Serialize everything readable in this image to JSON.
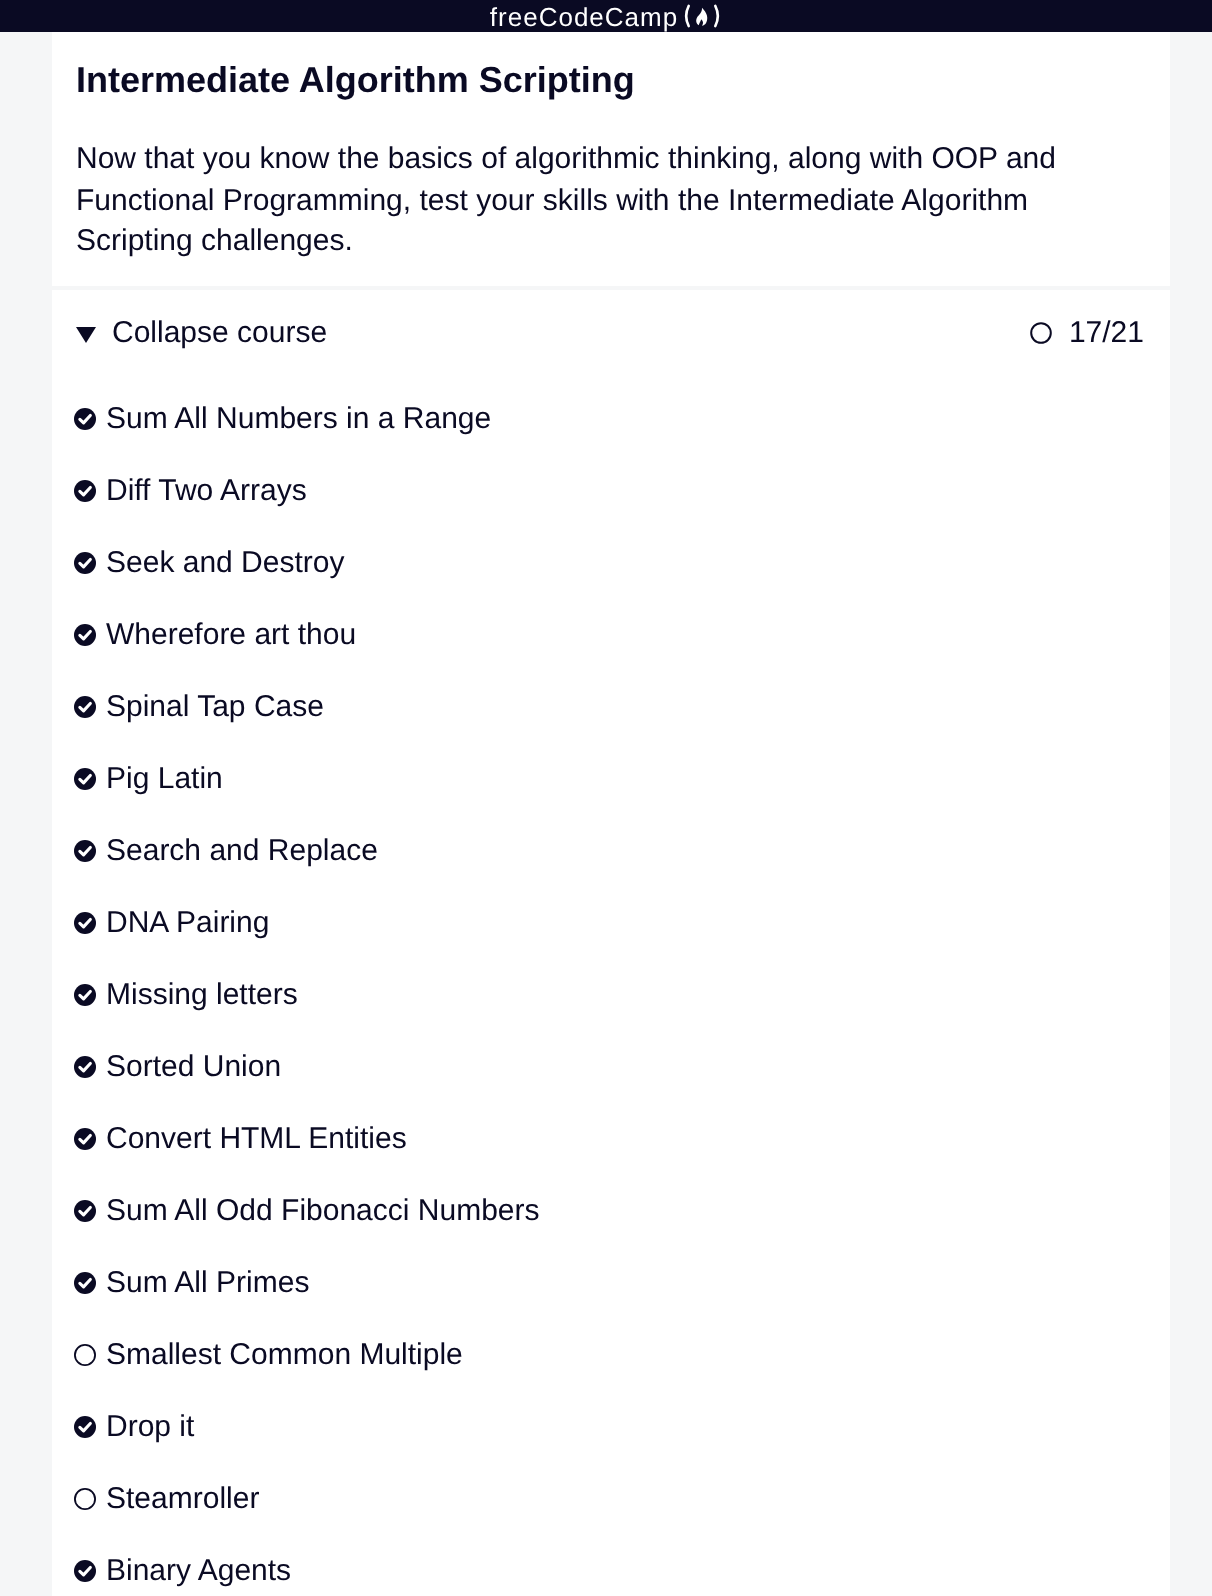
{
  "header": {
    "logo_text": "freeCodeCamp"
  },
  "intro": {
    "title": "Intermediate Algorithm Scripting",
    "description": "Now that you know the basics of algorithmic thinking, along with OOP and Functional Programming, test your skills with the Intermediate Algorithm Scripting challenges."
  },
  "course": {
    "toggle": {
      "label": "Collapse course",
      "expanded": true
    },
    "progress": {
      "text": "17/21",
      "complete": false
    },
    "challenges": [
      {
        "name": "Sum All Numbers in a Range",
        "completed": true
      },
      {
        "name": "Diff Two Arrays",
        "completed": true
      },
      {
        "name": "Seek and Destroy",
        "completed": true
      },
      {
        "name": "Wherefore art thou",
        "completed": true
      },
      {
        "name": "Spinal Tap Case",
        "completed": true
      },
      {
        "name": "Pig Latin",
        "completed": true
      },
      {
        "name": "Search and Replace",
        "completed": true
      },
      {
        "name": "DNA Pairing",
        "completed": true
      },
      {
        "name": "Missing letters",
        "completed": true
      },
      {
        "name": "Sorted Union",
        "completed": true
      },
      {
        "name": "Convert HTML Entities",
        "completed": true
      },
      {
        "name": "Sum All Odd Fibonacci Numbers",
        "completed": true
      },
      {
        "name": "Sum All Primes",
        "completed": true
      },
      {
        "name": "Smallest Common Multiple",
        "completed": false
      },
      {
        "name": "Drop it",
        "completed": true
      },
      {
        "name": "Steamroller",
        "completed": false
      },
      {
        "name": "Binary Agents",
        "completed": true
      }
    ]
  }
}
